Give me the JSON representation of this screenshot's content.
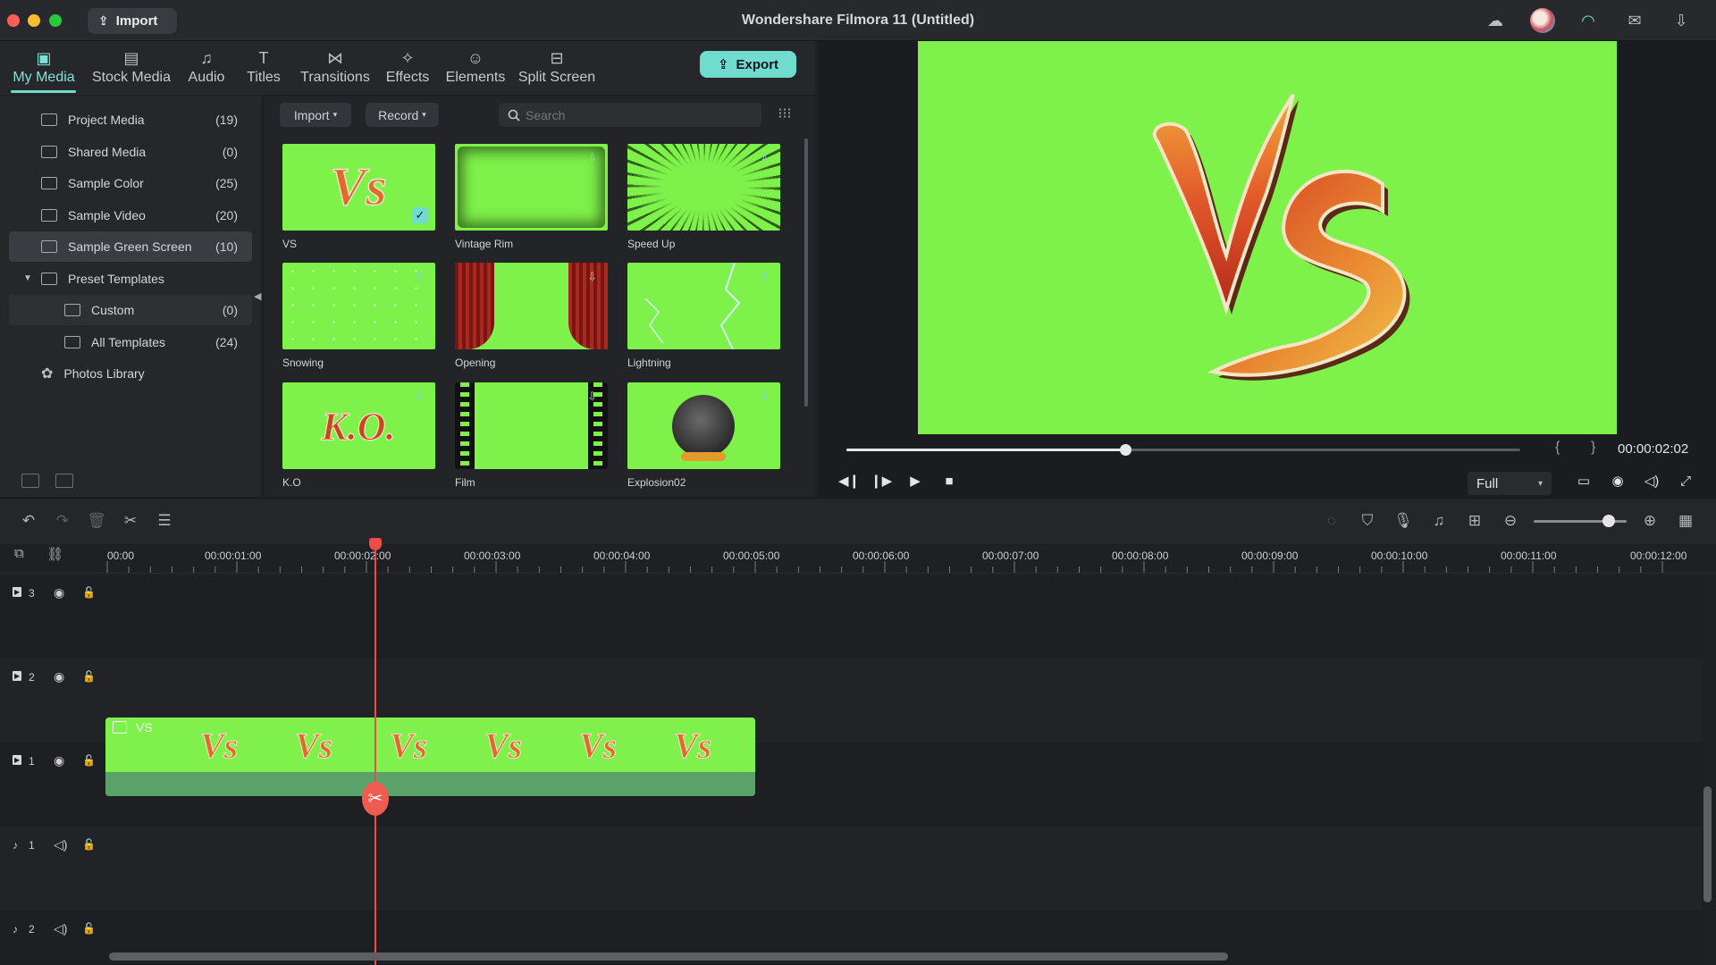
{
  "window": {
    "title": "Wondershare Filmora 11 (Untitled)",
    "import_label": "Import"
  },
  "tabs": [
    {
      "label": "My Media",
      "icon": "my-media-icon"
    },
    {
      "label": "Stock Media",
      "icon": "stock-media-icon"
    },
    {
      "label": "Audio",
      "icon": "audio-icon"
    },
    {
      "label": "Titles",
      "icon": "titles-icon"
    },
    {
      "label": "Transitions",
      "icon": "transitions-icon"
    },
    {
      "label": "Effects",
      "icon": "effects-icon"
    },
    {
      "label": "Elements",
      "icon": "elements-icon"
    },
    {
      "label": "Split Screen",
      "icon": "split-screen-icon"
    }
  ],
  "export_label": "Export",
  "library": [
    {
      "label": "Project Media",
      "count": "(19)"
    },
    {
      "label": "Shared Media",
      "count": "(0)"
    },
    {
      "label": "Sample Color",
      "count": "(25)"
    },
    {
      "label": "Sample Video",
      "count": "(20)"
    },
    {
      "label": "Sample Green Screen",
      "count": "(10)"
    },
    {
      "label": "Preset Templates",
      "count": ""
    },
    {
      "label": "Custom",
      "count": "(0)"
    },
    {
      "label": "All Templates",
      "count": "(24)"
    },
    {
      "label": "Photos Library",
      "count": ""
    }
  ],
  "media_toolbar": {
    "import_label": "Import",
    "record_label": "Record",
    "search_placeholder": "Search"
  },
  "media_items": [
    {
      "label": "VS"
    },
    {
      "label": "Vintage Rim"
    },
    {
      "label": "Speed Up"
    },
    {
      "label": "Snowing"
    },
    {
      "label": "Opening"
    },
    {
      "label": "Lightning"
    },
    {
      "label": "K.O"
    },
    {
      "label": "Film"
    },
    {
      "label": "Explosion02"
    }
  ],
  "preview": {
    "timecode": "00:00:02:02",
    "quality": "Full",
    "progress_fraction": 0.415
  },
  "ruler_labels": [
    "00:00",
    "00:00:01:00",
    "00:00:02:00",
    "00:00:03:00",
    "00:00:04:00",
    "00:00:05:00",
    "00:00:06:00",
    "00:00:07:00",
    "00:00:08:00",
    "00:00:09:00",
    "00:00:10:00",
    "00:00:11:00",
    "00:00:12:00"
  ],
  "tracks": [
    {
      "kind": "video",
      "number": "3"
    },
    {
      "kind": "video",
      "number": "2"
    },
    {
      "kind": "video",
      "number": "1"
    },
    {
      "kind": "audio",
      "number": "1"
    },
    {
      "kind": "audio",
      "number": "2"
    }
  ],
  "clip": {
    "label": "VS",
    "frame_text": "Vs"
  },
  "colors": {
    "accent": "#6fdccd",
    "green_screen": "#7ef14b",
    "playhead": "#ef4b47"
  }
}
